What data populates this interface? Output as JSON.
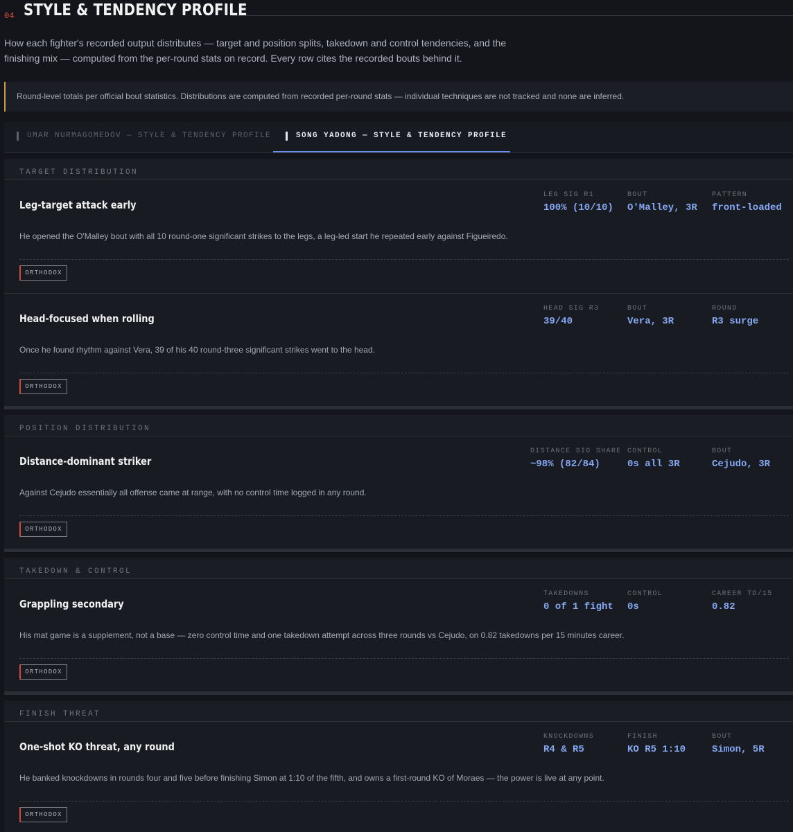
{
  "section": {
    "number": "04",
    "title": "STYLE & TENDENCY PROFILE",
    "intro_line1": "How each fighter's recorded output distributes — target and position splits, takedown and control tendencies, and the",
    "intro_line2": "finishing mix — computed from the per-round stats on record. Every row cites the recorded bouts behind it."
  },
  "notice": "Round-level totals per official bout statistics. Distributions are computed from recorded per-round stats — individual techniques are not tracked and none are inferred.",
  "tabs": [
    {
      "label": "UMAR NURMAGOMEDOV — STYLE & TENDENCY PROFILE",
      "active": false
    },
    {
      "label": "SONG YADONG — STYLE & TENDENCY PROFILE",
      "active": true
    }
  ],
  "groups": [
    {
      "heading": "TARGET DISTRIBUTION",
      "cards": [
        {
          "title": "Leg-target attack early",
          "stats": [
            {
              "label": "LEG SIG R1",
              "value": "100% (10/10)"
            },
            {
              "label": "BOUT",
              "value": "O'Malley, 3R"
            },
            {
              "label": "PATTERN",
              "value": "front-loaded"
            }
          ],
          "desc": "He opened the O'Malley bout with all 10 round-one significant strikes to the legs, a leg-led start he repeated early against Figueiredo.",
          "tag": "ORTHODOX"
        },
        {
          "title": "Head-focused when rolling",
          "stats": [
            {
              "label": "HEAD SIG R3",
              "value": "39/40"
            },
            {
              "label": "BOUT",
              "value": "Vera, 3R"
            },
            {
              "label": "ROUND",
              "value": "R3 surge"
            }
          ],
          "desc": "Once he found rhythm against Vera, 39 of his 40 round-three significant strikes went to the head.",
          "tag": "ORTHODOX"
        }
      ]
    },
    {
      "heading": "POSITION DISTRIBUTION",
      "cards": [
        {
          "title": "Distance-dominant striker",
          "stats": [
            {
              "label": "DISTANCE SIG SHARE",
              "value": "~98% (82/84)"
            },
            {
              "label": "CONTROL",
              "value": "0s all 3R"
            },
            {
              "label": "BOUT",
              "value": "Cejudo, 3R"
            }
          ],
          "desc": "Against Cejudo essentially all offense came at range, with no control time logged in any round.",
          "tag": "ORTHODOX"
        }
      ]
    },
    {
      "heading": "TAKEDOWN & CONTROL",
      "cards": [
        {
          "title": "Grappling secondary",
          "stats": [
            {
              "label": "TAKEDOWNS",
              "value": "0 of 1 fight"
            },
            {
              "label": "CONTROL",
              "value": "0s"
            },
            {
              "label": "CAREER TD/15",
              "value": "0.82"
            }
          ],
          "desc": "His mat game is a supplement, not a base — zero control time and one takedown attempt across three rounds vs Cejudo, on 0.82 takedowns per 15 minutes career.",
          "tag": "ORTHODOX"
        }
      ]
    },
    {
      "heading": "FINISH THREAT",
      "cards": [
        {
          "title": "One-shot KO threat, any round",
          "stats": [
            {
              "label": "KNOCKDOWNS",
              "value": "R4 & R5"
            },
            {
              "label": "FINISH",
              "value": "KO R5 1:10"
            },
            {
              "label": "BOUT",
              "value": "Simon, 5R"
            }
          ],
          "desc": "He banked knockdowns in rounds four and five before finishing Simon at 1:10 of the fifth, and owns a first-round KO of Moraes — the power is live at any point.",
          "tag": "ORTHODOX"
        }
      ]
    }
  ]
}
